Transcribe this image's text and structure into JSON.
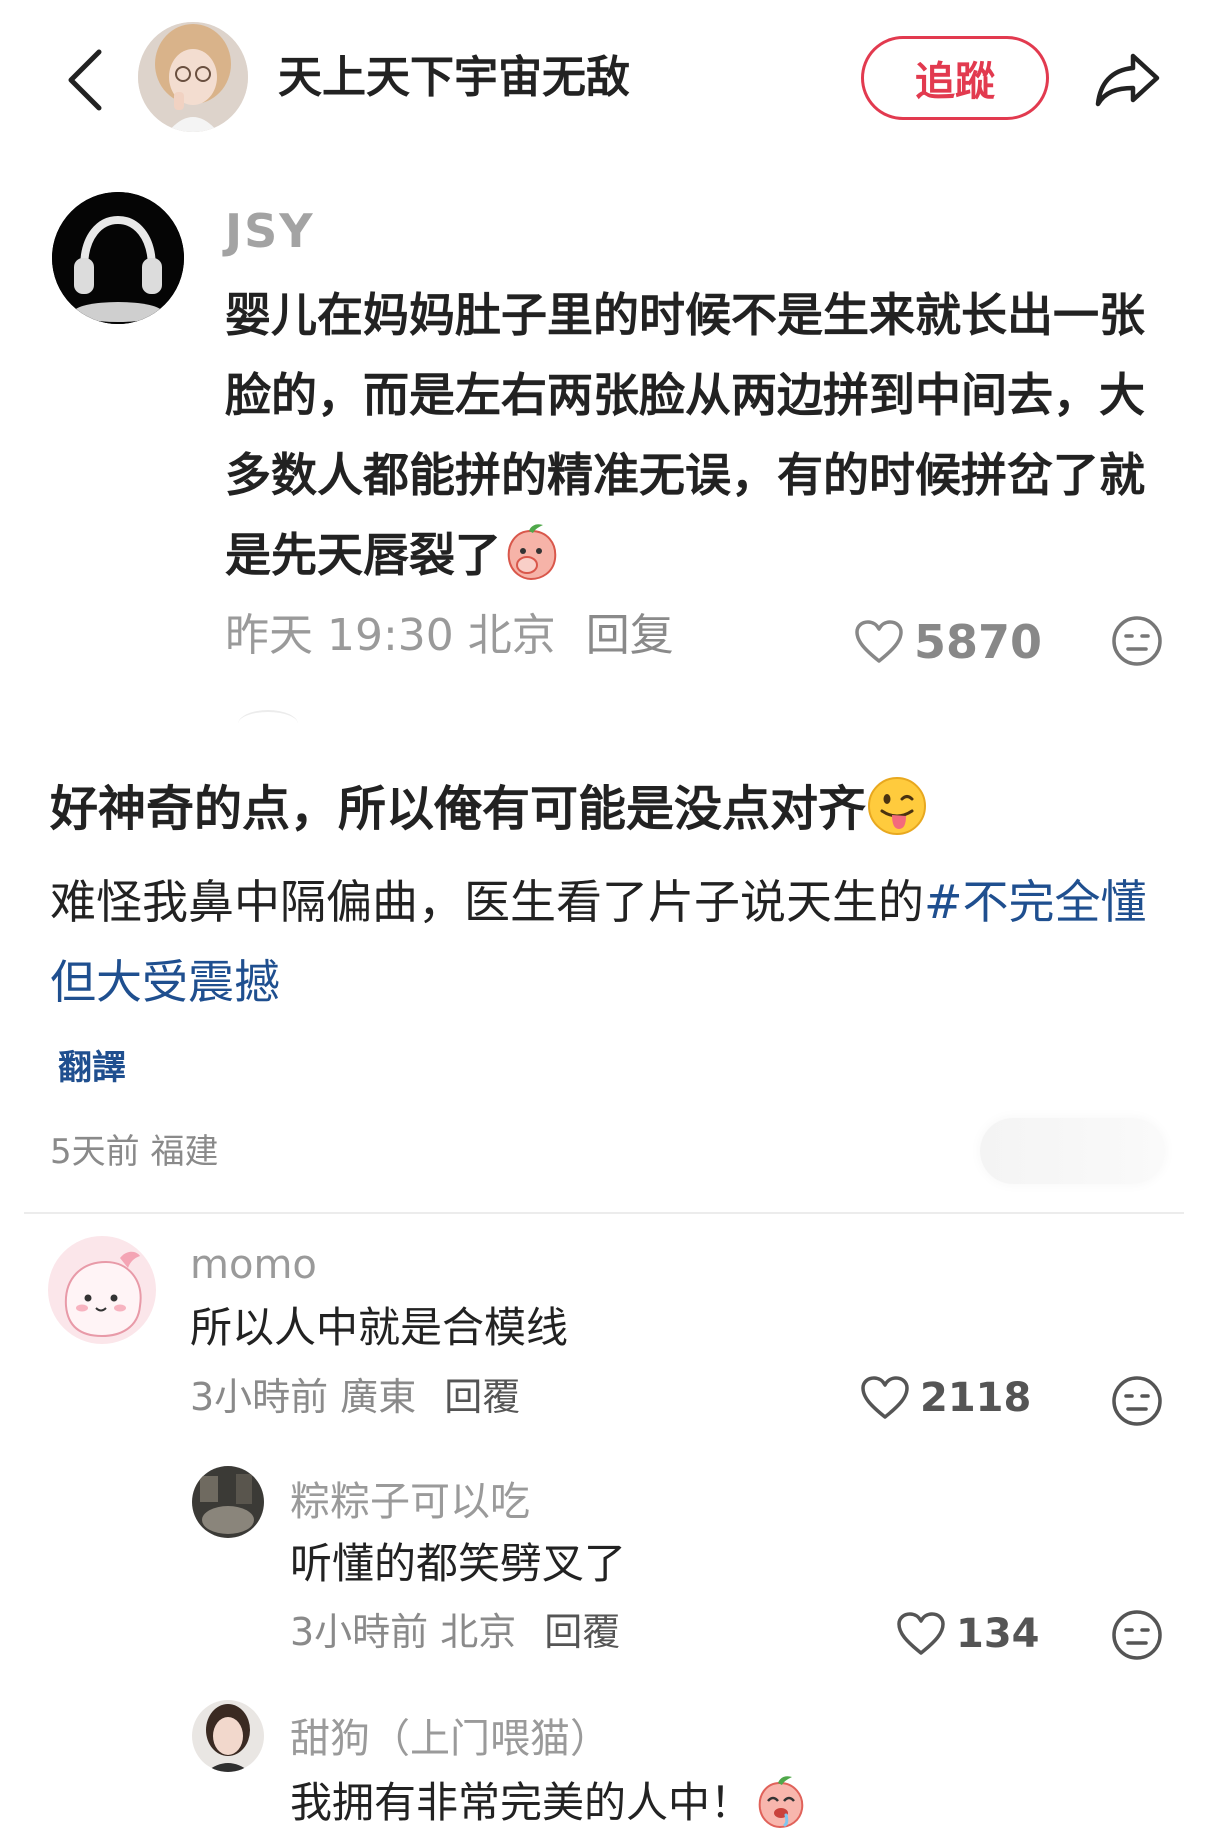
{
  "header": {
    "author_name": "天上天下宇宙无敌",
    "follow_label": "追蹤",
    "icons": {
      "back": "chevron-left-icon",
      "share": "share-arrow-icon"
    }
  },
  "quoted_comment": {
    "username": "JSY",
    "text": "婴儿在妈妈肚子里的时候不是生来就长出一张脸的，而是左右两张脸从两边拼到中间去，大多数人都能拼的精准无误，有的时候拼岔了就是先天唇裂了",
    "emoji": "peach-cover-mouth-emoji",
    "time_location": "昨天 19:30 北京",
    "reply_label": "回复",
    "likes": "5870"
  },
  "post": {
    "title": "好神奇的点，所以俺有可能是没点对齐",
    "title_emoji": "tongue-out-emoji",
    "body": "难怪我鼻中隔偏曲，医生看了片子说天生的",
    "hashtag": "#不完全懂但大受震撼",
    "translate_label": "翻譯",
    "time_location": "5天前 福建"
  },
  "comments": [
    {
      "username": "momo",
      "text": "所以人中就是合模线",
      "time_location": "3小時前 廣東",
      "reply_label": "回覆",
      "likes": "2118"
    },
    {
      "username": "粽粽子可以吃",
      "text": "听懂的都笑劈叉了",
      "time_location": "3小時前 北京",
      "reply_label": "回覆",
      "likes": "134"
    },
    {
      "username": "甜狗（上门喂猫）",
      "text": "我拥有非常完美的人中！",
      "emoji": "peach-drool-emoji"
    }
  ],
  "colors": {
    "accent_red": "#e23a4f",
    "hashtag_blue": "#1f4f8f",
    "muted_gray": "#9a9a9a"
  }
}
